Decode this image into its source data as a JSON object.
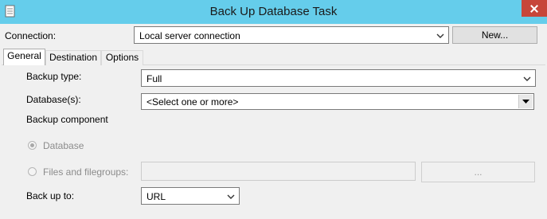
{
  "window": {
    "title": "Back Up Database Task"
  },
  "connection": {
    "label": "Connection:",
    "value": "Local server connection",
    "new_button": "New..."
  },
  "tabs": [
    {
      "label": "General",
      "active": true
    },
    {
      "label": "Destination",
      "active": false
    },
    {
      "label": "Options",
      "active": false
    }
  ],
  "general": {
    "backup_type": {
      "label": "Backup type:",
      "value": "Full"
    },
    "databases": {
      "label": "Database(s):",
      "value": "<Select one or more>"
    },
    "backup_component": {
      "label": "Backup component"
    },
    "component_options": [
      {
        "label": "Database",
        "selected": true,
        "enabled": false
      },
      {
        "label": "Files and filegroups:",
        "selected": false,
        "enabled": false
      }
    ],
    "filegroups_button": "...",
    "back_up_to": {
      "label": "Back up to:",
      "value": "URL"
    }
  },
  "colors": {
    "titlebar": "#65cdeb",
    "close": "#c7463a",
    "panel": "#f0f0f0"
  }
}
